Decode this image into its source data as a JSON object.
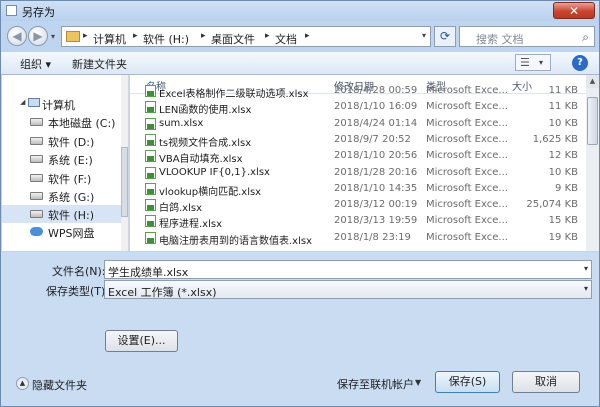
{
  "window": {
    "title": "另存为",
    "close_label": "✕"
  },
  "address": {
    "crumbs": [
      "计算机",
      "软件 (H:)",
      "桌面文件",
      "文档"
    ],
    "search_placeholder": "搜索 文档"
  },
  "toolbar": {
    "organize_label": "组织 ▾",
    "new_folder_label": "新建文件夹",
    "help_label": "?"
  },
  "nav": {
    "items": [
      {
        "label": "计算机",
        "icon": "computer-icon"
      },
      {
        "label": "本地磁盘 (C:)",
        "icon": "drive-icon"
      },
      {
        "label": "软件 (D:)",
        "icon": "drive-icon"
      },
      {
        "label": "系统 (E:)",
        "icon": "drive-icon"
      },
      {
        "label": "软件 (F:)",
        "icon": "drive-icon"
      },
      {
        "label": "系统 (G:)",
        "icon": "drive-icon"
      },
      {
        "label": "软件 (H:)",
        "icon": "drive-icon",
        "selected": true
      },
      {
        "label": "WPS网盘",
        "icon": "cloud-icon"
      }
    ]
  },
  "files": {
    "columns": [
      "名称",
      "修改日期",
      "类型",
      "大小"
    ],
    "rows": [
      {
        "name": "Excel表格制作二级联动选项.xlsx",
        "date": "2018/4/28 00:59",
        "type": "Microsoft Exce...",
        "size": "11 KB"
      },
      {
        "name": "LEN函数的使用.xlsx",
        "date": "2018/1/10 16:09",
        "type": "Microsoft Exce...",
        "size": "11 KB"
      },
      {
        "name": "sum.xlsx",
        "date": "2018/4/24 01:14",
        "type": "Microsoft Exce...",
        "size": "10 KB"
      },
      {
        "name": "ts视频文件合成.xlsx",
        "date": "2018/9/7 20:52",
        "type": "Microsoft Exce...",
        "size": "1,625 KB"
      },
      {
        "name": "VBA自动填充.xlsx",
        "date": "2018/1/10 20:56",
        "type": "Microsoft Exce...",
        "size": "12 KB"
      },
      {
        "name": "VLOOKUP IF{0,1}.xlsx",
        "date": "2018/1/28 20:16",
        "type": "Microsoft Exce...",
        "size": "10 KB"
      },
      {
        "name": "vlookup横向匹配.xlsx",
        "date": "2018/1/10 14:35",
        "type": "Microsoft Exce...",
        "size": "9 KB"
      },
      {
        "name": "白鸽.xlsx",
        "date": "2018/3/12 00:19",
        "type": "Microsoft Exce...",
        "size": "25,074 KB"
      },
      {
        "name": "程序进程.xlsx",
        "date": "2018/3/13 19:59",
        "type": "Microsoft Exce...",
        "size": "15 KB"
      },
      {
        "name": "电脑注册表用到的语言数值表.xlsx",
        "date": "2018/1/8 23:19",
        "type": "Microsoft Exce...",
        "size": "19 KB"
      }
    ]
  },
  "form": {
    "filename_label": "文件名(N):",
    "filename_value": "学生成绩单.xlsx",
    "filetype_label": "保存类型(T):",
    "filetype_value": "Excel 工作簿 (*.xlsx)",
    "settings_label": "设置(E)...",
    "hide_folders_label": "隐藏文件夹",
    "save_online_label": "保存至联机帐户",
    "save_label": "保存(S)",
    "cancel_label": "取消"
  }
}
